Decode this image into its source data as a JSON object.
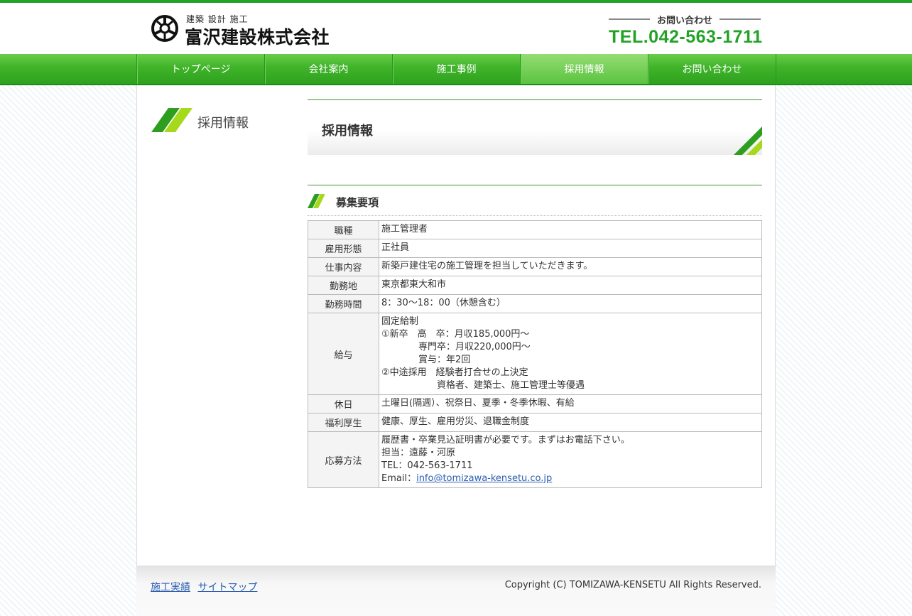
{
  "header": {
    "logo_sub": "建築 設計 施工",
    "logo_main": "富沢建設株式会社",
    "contact_label": "お問い合わせ",
    "contact_tel": "TEL.042-563-1711",
    "brand_color": "#22a326"
  },
  "nav": {
    "items": [
      {
        "label": "トップページ"
      },
      {
        "label": "会社案内"
      },
      {
        "label": "施工事例"
      },
      {
        "label": "採用情報"
      },
      {
        "label": "お問い合わせ"
      }
    ],
    "active_index": 3
  },
  "sidebar": {
    "title": "採用情報"
  },
  "page": {
    "title": "採用情報",
    "section_title": "募集要項"
  },
  "table": {
    "rows": [
      {
        "label": "職種",
        "lines": [
          "施工管理者"
        ]
      },
      {
        "label": "雇用形態",
        "lines": [
          "正社員"
        ]
      },
      {
        "label": "仕事内容",
        "lines": [
          "新築戸建住宅の施工管理を担当していただきます。"
        ]
      },
      {
        "label": "勤務地",
        "lines": [
          "東京都東大和市"
        ]
      },
      {
        "label": "勤務時間",
        "lines": [
          "8：30～18：00（休憩含む）"
        ]
      },
      {
        "label": "給与",
        "lines": [
          "固定給制",
          "①新卒　高　卒：月収185,000円～",
          "専門卒：月収220,000円～",
          "賞与：年2回",
          "②中途採用　経験者打合せの上決定",
          "資格者、建築士、施工管理士等優遇"
        ]
      },
      {
        "label": "休日",
        "lines": [
          "土曜日(隔週）、祝祭日、夏季・冬季休暇、有給"
        ]
      },
      {
        "label": "福利厚生",
        "lines": [
          "健康、厚生、雇用労災、退職金制度"
        ]
      },
      {
        "label": "応募方法",
        "lines": [
          "履歴書・卒業見込証明書が必要です。まずはお電話下さい。",
          "担当：遠藤・河原",
          "TEL：042-563-1711"
        ],
        "email_prefix": "Email：",
        "email": "info@tomizawa-kensetu.co.jp"
      }
    ]
  },
  "footer": {
    "links": [
      "施工実績",
      "サイトマップ"
    ],
    "copyright": "Copyright (C) TOMIZAWA-KENSETU All Rights Reserved."
  }
}
